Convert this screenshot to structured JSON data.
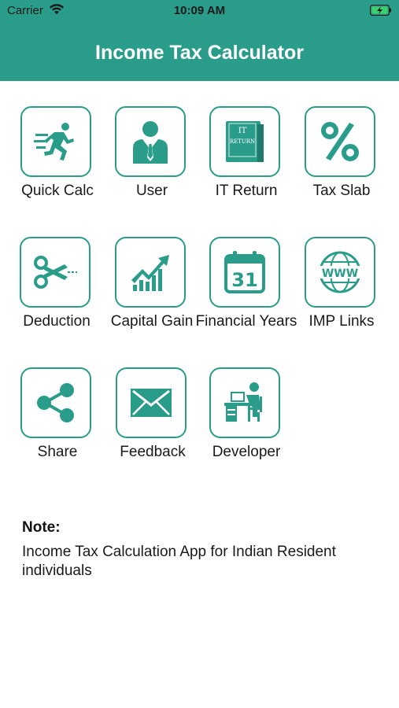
{
  "status": {
    "carrier": "Carrier",
    "time": "10:09 AM"
  },
  "header": {
    "title": "Income Tax Calculator"
  },
  "tiles": [
    {
      "label": "Quick Calc",
      "icon": "running-man-icon"
    },
    {
      "label": "User",
      "icon": "user-icon"
    },
    {
      "label": "IT Return",
      "icon": "it-return-book-icon",
      "icon_text": [
        "IT",
        "RETURN"
      ]
    },
    {
      "label": "Tax Slab",
      "icon": "percent-icon"
    },
    {
      "label": "Deduction",
      "icon": "scissors-icon"
    },
    {
      "label": "Capital Gain",
      "icon": "growth-chart-icon"
    },
    {
      "label": "Financial Years",
      "icon": "calendar-icon",
      "icon_text": [
        "31"
      ]
    },
    {
      "label": "IMP Links",
      "icon": "globe-www-icon",
      "icon_text": [
        "WWW"
      ]
    },
    {
      "label": "Share",
      "icon": "share-icon"
    },
    {
      "label": "Feedback",
      "icon": "envelope-icon"
    },
    {
      "label": "Developer",
      "icon": "developer-desk-icon"
    }
  ],
  "note": {
    "title": "Note:",
    "text": "Income Tax Calculation App for Indian Resident individuals"
  },
  "colors": {
    "accent": "#2a9d8a",
    "text": "#1a1a1a",
    "background": "#ffffff"
  }
}
